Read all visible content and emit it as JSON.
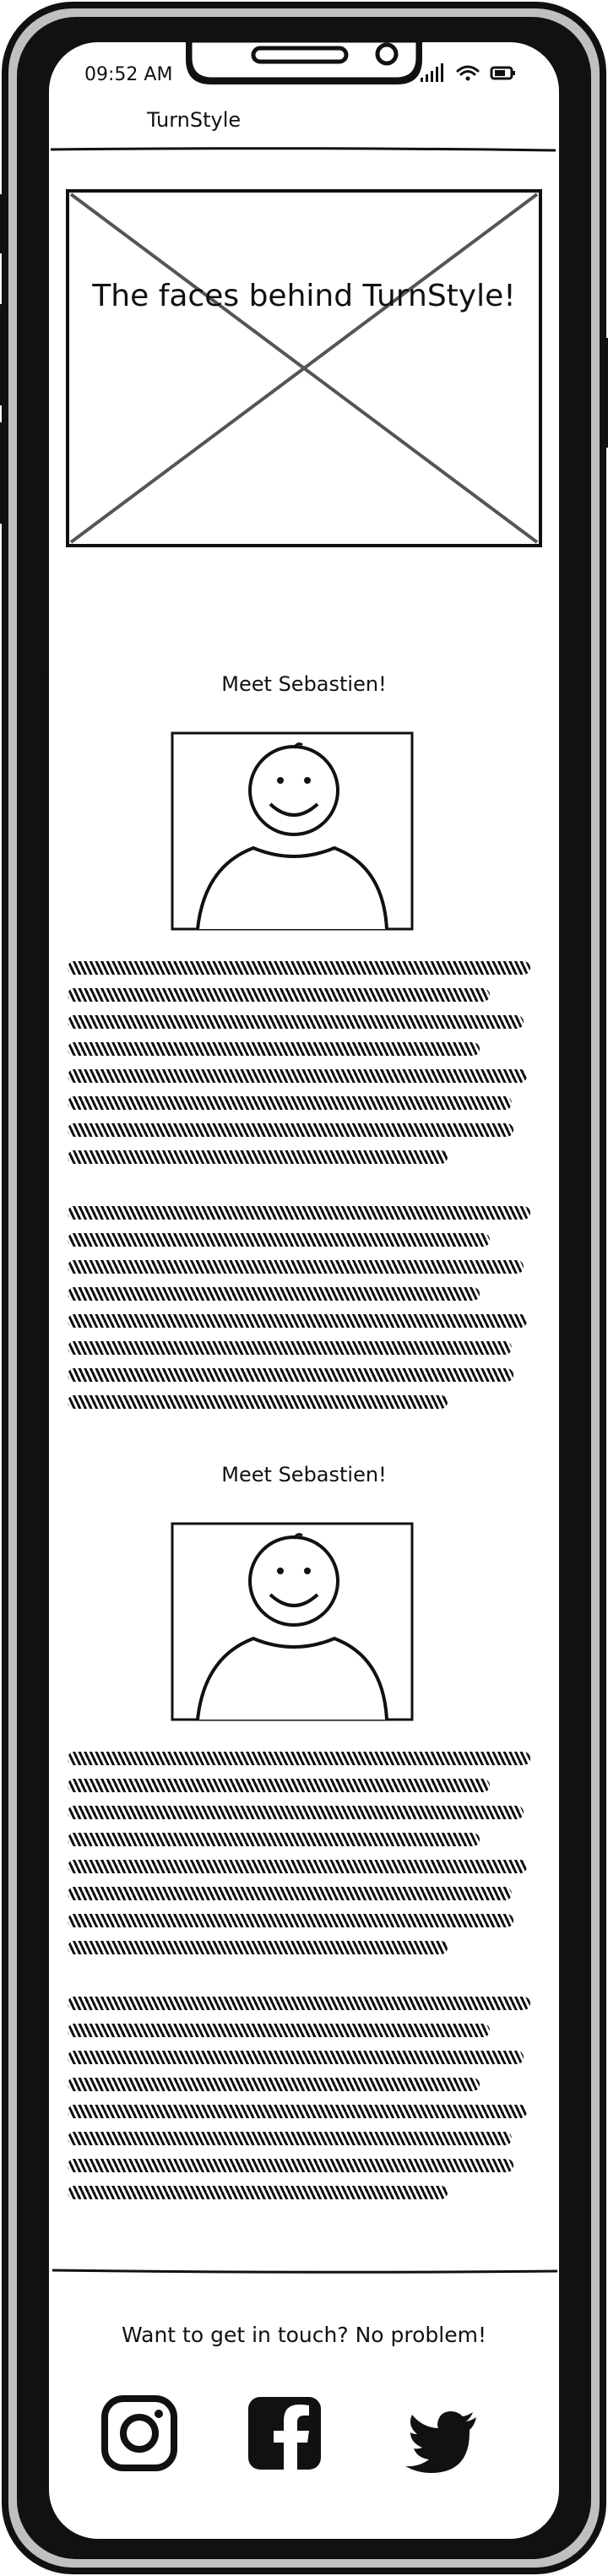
{
  "status_bar": {
    "time": "09:52 AM"
  },
  "header": {
    "title": "TurnStyle"
  },
  "hero": {
    "title": "The faces behind TurnStyle!"
  },
  "profiles": [
    {
      "heading": "Meet Sebastien!"
    },
    {
      "heading": "Meet Sebastien!"
    }
  ],
  "footer": {
    "contact_text": "Want to get in touch? No problem!",
    "social_icons": [
      "instagram-icon",
      "facebook-icon",
      "twitter-icon"
    ]
  },
  "colors": {
    "ink": "#111111",
    "frame_gray": "#c0c0c0",
    "placeholder_gray": "#555555"
  }
}
